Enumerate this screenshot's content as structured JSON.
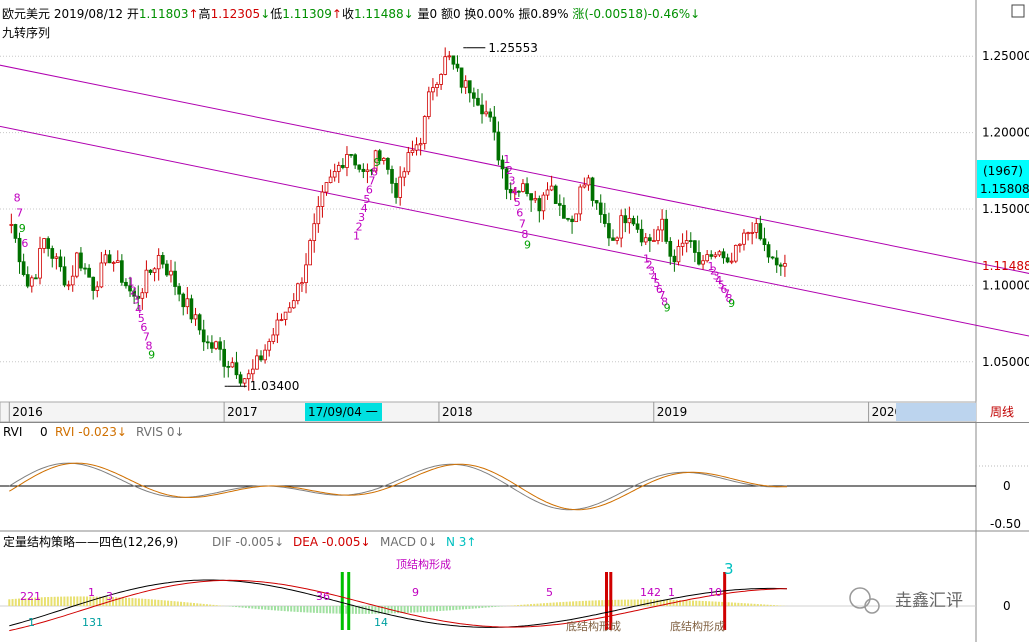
{
  "header": {
    "symbol": "欧元美元",
    "date": "2019/08/12",
    "open_label": "开",
    "open": "1.11803",
    "open_arrow": "↑",
    "high_label": "高",
    "high": "1.12305",
    "high_arrow": "↓",
    "low_label": "低",
    "low": "1.11309",
    "low_arrow": "↑",
    "close_label": "收",
    "close": "1.11488",
    "close_arrow": "↓",
    "volume": "量0",
    "amount": "额0",
    "turnover": "换0.00%",
    "amplitude": "振0.89%",
    "change_label": "涨",
    "change": "(-0.00518)-0.46%",
    "change_arrow": "↓",
    "indicator_name": "九转序列"
  },
  "colors": {
    "up": "#d00000",
    "down": "#007000",
    "channel": "#b000b0",
    "td_count": "#c000c0",
    "td_count_green": "#00a000",
    "axis_highlight": "#00e0e0",
    "right_tag": "#00ffff",
    "rvi": "#808080",
    "rvis": "#d07000"
  },
  "chart_data": [
    {
      "type": "candlestick",
      "title": "欧元美元 周线",
      "timeframe_label": "周线",
      "ylim": [
        1.025,
        1.275
      ],
      "y_ticks": [
        "1.25000",
        "1.20000",
        "1.15000",
        "1.10000",
        "1.05000"
      ],
      "x_ticks": [
        "2016",
        "2017",
        "2018",
        "2019",
        "2020"
      ],
      "cursor_date_label": "17/09/04 一",
      "annotations": [
        {
          "text": "1.25553",
          "date": "2018-02-12",
          "price": 1.25553
        },
        {
          "text": "1.03400",
          "date": "2017-01-02",
          "price": 1.034
        }
      ],
      "right_tags": [
        "(1967)",
        "1.15808"
      ],
      "last_price_label": "1.11488",
      "channel_lines": [
        {
          "from": [
            "2015-10",
            1.25
          ],
          "to": [
            "2020-12",
            1.103
          ]
        },
        {
          "from": [
            "2015-10",
            1.21
          ],
          "to": [
            "2020-12",
            1.062
          ]
        }
      ],
      "weekly_closes_approx": {
        "2016": [
          1.14,
          1.12,
          1.1,
          1.11,
          1.13,
          1.12,
          1.11,
          1.1,
          1.12,
          1.11,
          1.1,
          1.11,
          1.12,
          1.11,
          1.1,
          1.09,
          1.1,
          1.11,
          1.12,
          1.11,
          1.1,
          1.09,
          1.08,
          1.07,
          1.06,
          1.06,
          1.05,
          1.05,
          1.04
        ],
        "2017": [
          1.04,
          1.05,
          1.06,
          1.07,
          1.08,
          1.09,
          1.1,
          1.12,
          1.14,
          1.16,
          1.17,
          1.18,
          1.19,
          1.18,
          1.17,
          1.18,
          1.19,
          1.17,
          1.16,
          1.18,
          1.19,
          1.2,
          1.23
        ],
        "2018": [
          1.24,
          1.25,
          1.24,
          1.23,
          1.23,
          1.22,
          1.21,
          1.19,
          1.17,
          1.16,
          1.17,
          1.16,
          1.15,
          1.17,
          1.16,
          1.15,
          1.14,
          1.16,
          1.17,
          1.15,
          1.14,
          1.13,
          1.14,
          1.15
        ],
        "2019": [
          1.14,
          1.13,
          1.13,
          1.14,
          1.12,
          1.12,
          1.13,
          1.12,
          1.11,
          1.12,
          1.12,
          1.11,
          1.12,
          1.13,
          1.14,
          1.13,
          1.12,
          1.11,
          1.115
        ]
      },
      "td_labels": [
        "8",
        "7",
        "9",
        "6",
        "1",
        "2",
        "3",
        "4",
        "5",
        "6",
        "7",
        "8",
        "9",
        "1",
        "2",
        "3",
        "4",
        "5",
        "6",
        "7",
        "8",
        "9",
        "1",
        "2",
        "3",
        "4",
        "5",
        "6",
        "7",
        "8",
        "9",
        "1",
        "2",
        "3",
        "4",
        "5",
        "6",
        "7",
        "8",
        "9"
      ]
    },
    {
      "type": "line",
      "title_parts": [
        "RVI",
        "0",
        "RVI -0.023↓",
        "RVIS 0↓"
      ],
      "series": [
        {
          "name": "RVI",
          "value_label": "RVI -0.023↓"
        },
        {
          "name": "RVIS",
          "value_label": "RVIS 0↓"
        }
      ],
      "ylim": [
        -0.6,
        0.6
      ],
      "y_ticks": [
        "0",
        "-0.50"
      ]
    },
    {
      "type": "bar",
      "title": "定量结构策略——四色(12,26,9)",
      "series": [
        {
          "name": "DIF",
          "value_label": "DIF -0.005↓"
        },
        {
          "name": "DEA",
          "value_label": "DEA -0.005↓"
        },
        {
          "name": "MACD",
          "value_label": "MACD 0↓"
        },
        {
          "name": "N",
          "value_label": "N 3↑"
        }
      ],
      "y_ticks": [
        "0"
      ],
      "number_labels": [
        "221",
        "1",
        "3",
        "1",
        "131",
        "36",
        "14",
        "9",
        "5",
        "14",
        "2",
        "1",
        "10",
        "3"
      ],
      "text_labels": [
        "顶结构形成",
        "底结构形成",
        "底结构形成"
      ]
    }
  ],
  "watermark": {
    "text": "垚鑫汇评"
  }
}
